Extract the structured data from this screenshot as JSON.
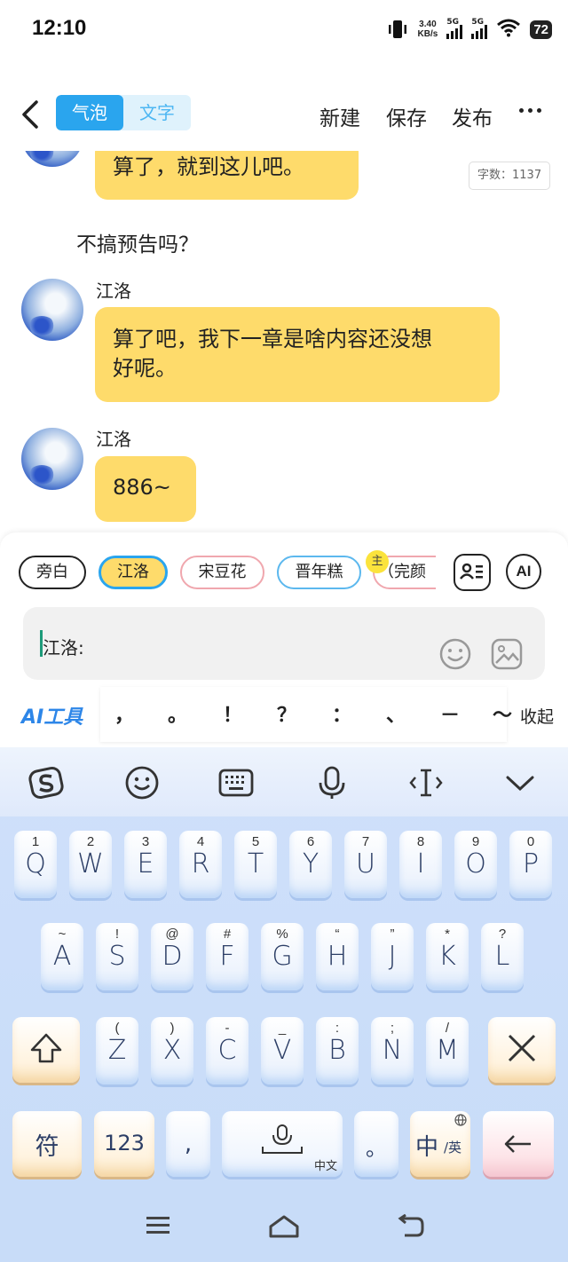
{
  "status_bar": {
    "time": "12:10",
    "speed_value": "3.40",
    "speed_unit": "KB/s",
    "sim1": "5G",
    "sim2": "5G",
    "battery": "72"
  },
  "header": {
    "mode_tabs": [
      "气泡",
      "文字"
    ],
    "active_tab": "气泡",
    "new_label": "新建",
    "save_label": "保存",
    "publish_label": "发布"
  },
  "chat": {
    "word_count": "字数：1137",
    "messages": [
      {
        "speaker": "",
        "text": "算了，就到这儿吧。"
      },
      {
        "narration": "不搞预告吗？"
      },
      {
        "speaker": "江洛",
        "text": "算了吧，我下一章是啥内容还没想好呢。"
      },
      {
        "speaker": "江洛",
        "text": "886~"
      }
    ],
    "bubble_lines": {
      "m2_line1": "算了吧，我下一章是啥内容还没想",
      "m2_line2": "好呢。"
    }
  },
  "roles": {
    "chips": [
      "旁白",
      "江洛",
      "宋豆花",
      "晋年糕",
      "（完颜"
    ],
    "selected": "江洛",
    "protagonist_badge": "主",
    "ai_label": "AI"
  },
  "input": {
    "value": "江洛:"
  },
  "toolbar": {
    "ai_tools_label": "AI工具",
    "punctuation": [
      "，",
      "。",
      "！",
      "？",
      "：",
      "、",
      "－",
      "～"
    ],
    "collapse_label": "收起"
  },
  "keyboard": {
    "row1": [
      {
        "sub": "1",
        "key": "Q"
      },
      {
        "sub": "2",
        "key": "W"
      },
      {
        "sub": "3",
        "key": "E"
      },
      {
        "sub": "4",
        "key": "R"
      },
      {
        "sub": "5",
        "key": "T"
      },
      {
        "sub": "6",
        "key": "Y"
      },
      {
        "sub": "7",
        "key": "U"
      },
      {
        "sub": "8",
        "key": "I"
      },
      {
        "sub": "9",
        "key": "O"
      },
      {
        "sub": "0",
        "key": "P"
      }
    ],
    "row2": [
      {
        "sub": "~",
        "key": "A"
      },
      {
        "sub": "!",
        "key": "S"
      },
      {
        "sub": "@",
        "key": "D"
      },
      {
        "sub": "#",
        "key": "F"
      },
      {
        "sub": "%",
        "key": "G"
      },
      {
        "sub": "“",
        "key": "H"
      },
      {
        "sub": "”",
        "key": "J"
      },
      {
        "sub": "*",
        "key": "K"
      },
      {
        "sub": "?",
        "key": "L"
      }
    ],
    "row3": [
      {
        "sub": "(",
        "key": "Z"
      },
      {
        "sub": ")",
        "key": "X"
      },
      {
        "sub": "-",
        "key": "C"
      },
      {
        "sub": "_",
        "key": "V"
      },
      {
        "sub": ":",
        "key": "B"
      },
      {
        "sub": ";",
        "key": "N"
      },
      {
        "sub": "/",
        "key": "M"
      }
    ],
    "symbol_key": "符",
    "number_key": "123",
    "comma_key": ",",
    "space_sub": "中文",
    "period_key": "。",
    "lang_key_main": "中",
    "lang_key_sub": "/英"
  }
}
